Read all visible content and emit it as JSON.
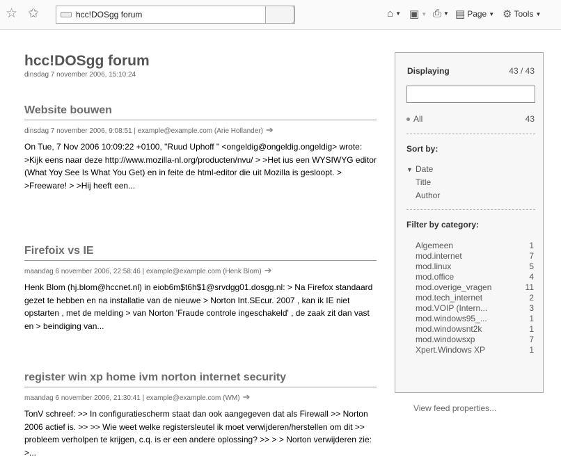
{
  "toolbar": {
    "tab_title": "hcc!DOSgg forum",
    "page_label": "Page",
    "tools_label": "Tools"
  },
  "site": {
    "title": "hcc!DOSgg forum",
    "date": "dinsdag 7 november 2006, 15:10:24"
  },
  "posts": [
    {
      "title": "Website bouwen",
      "meta": "dinsdag 7 november 2006, 9:08:51 | example@example.com (Arie Hollander)",
      "body": "On Tue, 7 Nov 2006 10:09:22 +0100, \"Ruud Uphoff \" <ongeldig@ongeldig.ongeldig> wrote: >Kijk eens naar deze http://www.mozilla-nl.org/producten/nvu/ > >Het ius een WYSIWYG editor (What Yoy See Is What You Get) en in feite de html-editor die uit Mozilla is gesloopt. > >Freeware! > >Hij heeft een..."
    },
    {
      "title": "Firefoix vs IE",
      "meta": "maandag 6 november 2006, 22:58:46 | example@example.com (Henk Blom)",
      "body": "Henk Blom (hj.blom@hccnet.nl) in eiob6m$t6h$1@srvdgg01.dosgg.nl: > Na Firefox standaard gezet te hebben en na installatie van de nieuwe > Norton Int.SEcur. 2007 , kan ik IE niet opstarten , met de melding > van Norton 'Fraude controle ingeschakeld' , de zaak zit dan vast en > beindiging van..."
    },
    {
      "title": "register win xp home ivm norton internet security",
      "meta": "maandag 6 november 2006, 21:30:41 | example@example.com (WM)",
      "body": "TonV schreef: >> In configuratiescherm staat dan ook aangegeven dat als Firewall >> Norton 2006 actief is. >> >> Wie weet welke registersleutel ik moet verwijderen/herstellen om dit >> probleem verholpen te krijgen, c.q. is er een andere oplossing? >> > > Norton verwijderen zie: >..."
    }
  ],
  "sidebar": {
    "displaying_label": "Displaying",
    "displaying_count": "43 / 43",
    "all_label": "All",
    "all_count": "43",
    "sort_heading": "Sort by:",
    "sort_options": [
      "Date",
      "Title",
      "Author"
    ],
    "filter_heading": "Filter by category:",
    "categories": [
      {
        "name": "Algemeen",
        "count": "1"
      },
      {
        "name": "mod.internet",
        "count": "7"
      },
      {
        "name": "mod.linux",
        "count": "5"
      },
      {
        "name": "mod.office",
        "count": "4"
      },
      {
        "name": "mod.overige_vragen",
        "count": "11"
      },
      {
        "name": "mod.tech_internet",
        "count": "2"
      },
      {
        "name": "mod.VOIP (Intern...",
        "count": "3"
      },
      {
        "name": "mod.windows95_...",
        "count": "1"
      },
      {
        "name": "mod.windowsnt2k",
        "count": "1"
      },
      {
        "name": "mod.windowsxp",
        "count": "7"
      },
      {
        "name": "Xpert.Windows XP",
        "count": "1"
      }
    ]
  },
  "footer": {
    "feed_properties": "View feed properties..."
  }
}
